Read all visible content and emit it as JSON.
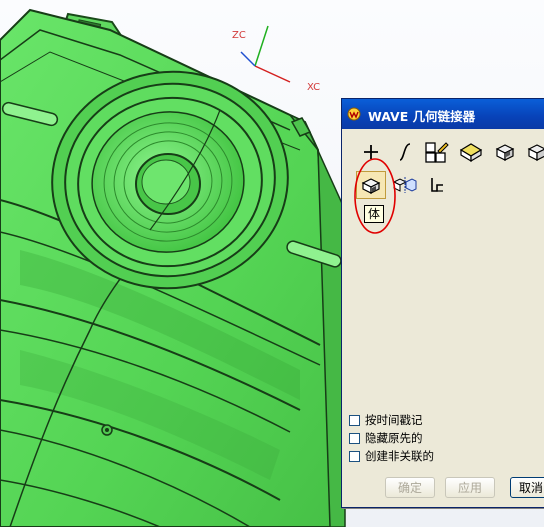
{
  "viewport": {
    "axis_x_label": "XC",
    "axis_z_label": "ZC",
    "model_color": "#5ddd5d"
  },
  "dialog": {
    "title": "WAVE 几何链接器",
    "toolbar_row1": [
      "point-icon",
      "curve-icon",
      "sketch-icon",
      "face-icon",
      "region-of-faces-icon",
      "body-icon"
    ],
    "toolbar_row2": [
      "body-icon",
      "mirror-body-icon",
      "routing-object-icon"
    ],
    "selected_icon": "body-icon",
    "tooltip": "体",
    "options": [
      {
        "label": "按时间戳记",
        "checked": false
      },
      {
        "label": "隐藏原先的",
        "checked": false
      },
      {
        "label": "创建非关联的",
        "checked": false
      }
    ],
    "buttons": {
      "ok": "确定",
      "apply": "应用",
      "cancel": "取消"
    },
    "accent_color": "#0a46c4",
    "annotation_color": "#e00000"
  }
}
